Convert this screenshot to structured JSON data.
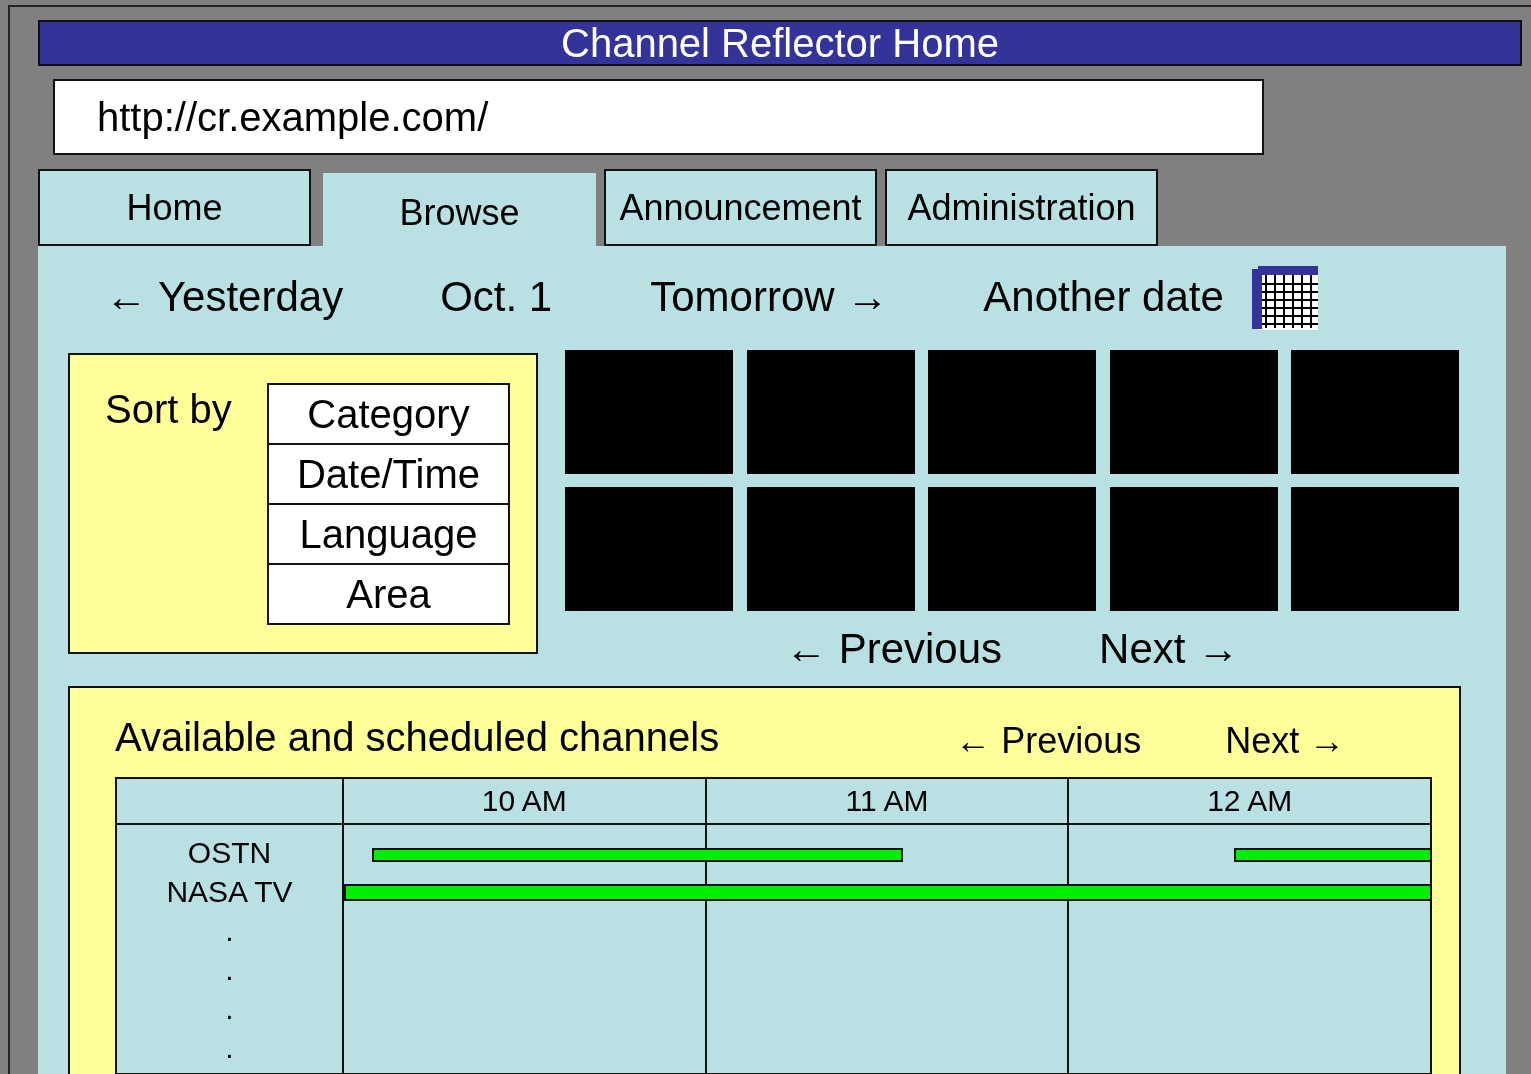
{
  "window": {
    "title": "Channel Reflector Home"
  },
  "address_bar": {
    "value": "http://cr.example.com/"
  },
  "tabs": [
    {
      "label": "Home",
      "selected": false
    },
    {
      "label": "Browse",
      "selected": true
    },
    {
      "label": "Announcement",
      "selected": false
    },
    {
      "label": "Administration",
      "selected": false
    }
  ],
  "date_nav": {
    "previous": "← Yesterday",
    "current": "Oct. 1",
    "next": "Tomorrow →",
    "other": "Another date"
  },
  "sort": {
    "label": "Sort by",
    "options": [
      "Category",
      "Date/Time",
      "Language",
      "Area"
    ]
  },
  "thumbnails": [
    {
      "kind": "blank"
    },
    {
      "kind": "blank"
    },
    {
      "kind": "blank"
    },
    {
      "kind": "blank"
    },
    {
      "kind": "blank"
    },
    {
      "kind": "blank"
    },
    {
      "kind": "blank"
    },
    {
      "kind": "blank"
    },
    {
      "kind": "blank"
    },
    {
      "kind": "blank"
    }
  ],
  "thumbnail_nav": {
    "previous": "← Previous",
    "next": "Next →"
  },
  "schedule": {
    "title": "Available and scheduled channels",
    "previous": "← Previous",
    "next": "Next →",
    "columns": [
      "10 AM",
      "11 AM",
      "12 AM"
    ],
    "channels": [
      "OSTN",
      "NASA TV",
      ".",
      ".",
      ".",
      "."
    ]
  }
}
